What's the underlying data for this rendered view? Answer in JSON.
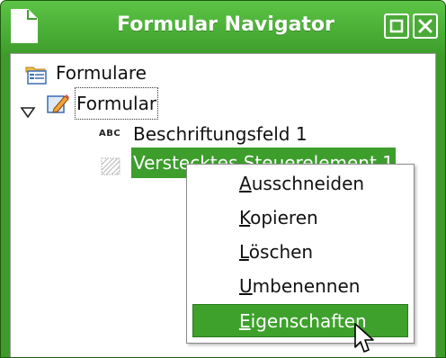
{
  "window": {
    "title": "Formular Navigator"
  },
  "tree": {
    "root_label": "Formulare",
    "form_label": "Formular",
    "children": [
      {
        "badge": "ABC",
        "label": "Beschriftungsfeld 1"
      },
      {
        "label": "Verstecktes Steuerelement 1",
        "selected": true
      }
    ]
  },
  "context_menu": {
    "items": [
      {
        "accel": "A",
        "rest": "usschneiden"
      },
      {
        "accel": "K",
        "rest": "opieren"
      },
      {
        "accel": "L",
        "rest": "öschen"
      },
      {
        "accel": "U",
        "rest": "mbenennen"
      },
      {
        "accel": "E",
        "rest": "igenschaften",
        "highlighted": true
      }
    ]
  },
  "colors": {
    "titlebar": "#4bb237",
    "selection": "#3d9e2c",
    "menu_highlight": "#3ea12c"
  },
  "icons": [
    "document-icon",
    "minimize-icon",
    "close-icon",
    "folder-form-icon",
    "expander-down-icon",
    "form-edit-icon",
    "hidden-control-icon",
    "mouse-pointer-icon"
  ]
}
